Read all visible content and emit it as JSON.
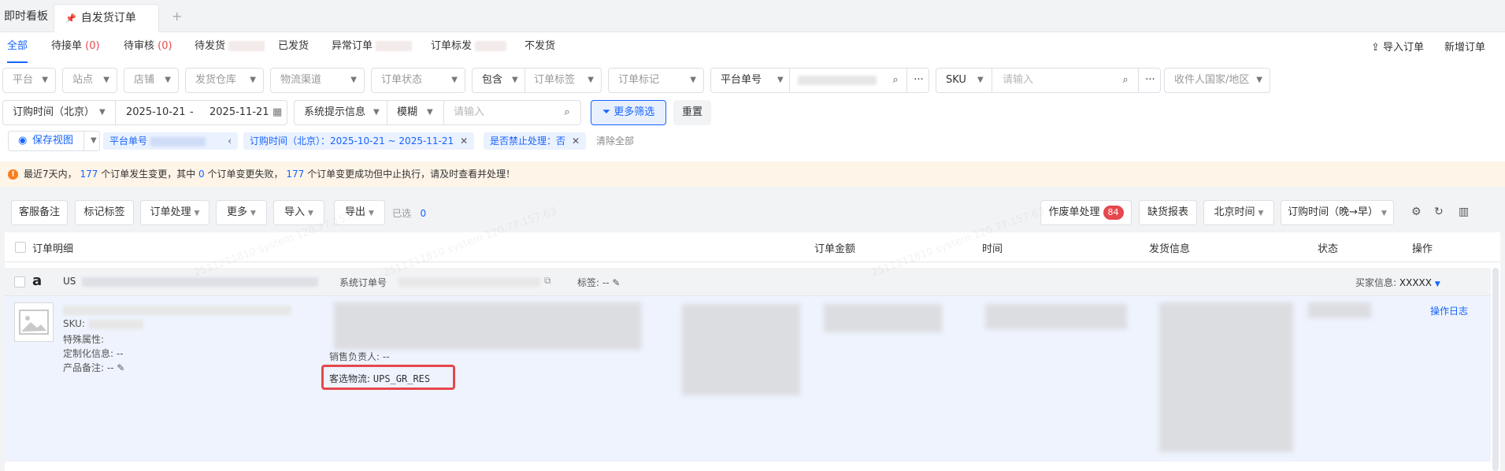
{
  "page_tabs": {
    "tab1": "即时看板",
    "tab2": "自发货订单",
    "add": "+"
  },
  "status_tabs": {
    "all": "全部",
    "pending_accept": "待接单",
    "pending_accept_count": "(0)",
    "pending_review": "待审核",
    "pending_review_count": "(0)",
    "pending_ship": "待发货",
    "shipped": "已发货",
    "abnormal": "异常订单",
    "order_mark": "订单标发",
    "no_ship": "不发货"
  },
  "actions": {
    "import_orders": "导入订单",
    "new_order": "新增订单"
  },
  "filters": {
    "platform": "平台",
    "site": "站点",
    "shop": "店铺",
    "warehouse": "发货仓库",
    "logistics": "物流渠道",
    "order_status": "订单状态",
    "contains": "包含",
    "order_tag": "订单标签",
    "order_mark": "订单标记",
    "platform_order_no": "平台单号",
    "sku": "SKU",
    "sku_placeholder": "请输入",
    "recipient_country": "收件人国家/地区",
    "order_time_label": "订购时间（北京）",
    "date_start": "2025-10-21",
    "date_sep": "-",
    "date_end": "2025-11-21",
    "system_hint": "系统提示信息",
    "fuzzy": "模糊",
    "hint_placeholder": "请输入",
    "more_filters": "更多筛选",
    "reset": "重置"
  },
  "chips": {
    "save_view": "保存视图",
    "platform_order_no": "平台单号",
    "order_time": "订购时间（北京）：2025-10-21 ~ 2025-11-21",
    "forbid": "是否禁止处理：否",
    "clear_all": "清除全部"
  },
  "alert": {
    "prefix": "最近7天内，",
    "count1": "177",
    "mid1": "个订单发生变更，其中",
    "count2": "0",
    "mid2": "个订单变更失败，",
    "count3": "177",
    "suffix": "个订单变更成功但中止执行，请及时查看并处理！"
  },
  "toolbar": {
    "cs_note": "客服备注",
    "mark_tag": "标记标签",
    "order_process": "订单处理",
    "more": "更多",
    "import": "导入",
    "export": "导出",
    "selected_label": "已选",
    "selected_count": "0",
    "void_process": "作废单处理",
    "void_count": "84",
    "shortage_report": "缺货报表",
    "beijing_time": "北京时间",
    "sort": "订购时间（晚→早）"
  },
  "table": {
    "col_detail": "订单明细",
    "col_amount": "订单金额",
    "col_time": "时间",
    "col_ship": "发货信息",
    "col_status": "状态",
    "col_ops": "操作"
  },
  "order": {
    "country": "US",
    "sys_order_label": "系统订单号",
    "tag_label": "标签:",
    "tag_value": "--",
    "buyer_label": "买家信息:",
    "buyer_value": "XXXXX",
    "sku_label": "SKU:",
    "special_attr": "特殊属性:",
    "custom_info": "定制化信息:",
    "custom_value": "--",
    "product_note": "产品备注:",
    "product_note_value": "--",
    "sales_owner": "销售负责人:",
    "sales_owner_value": "--",
    "pref_logistics_label": "客选物流:",
    "pref_logistics_value": "UPS_GR_RES",
    "op_log": "操作日志"
  }
}
